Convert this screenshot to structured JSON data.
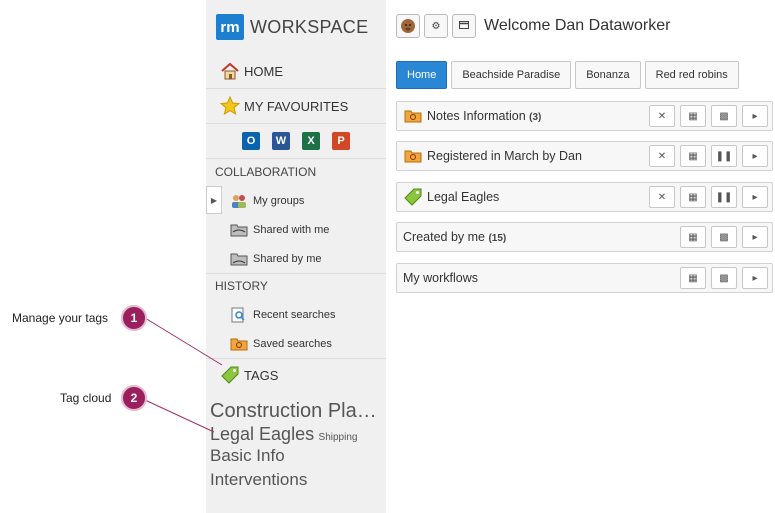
{
  "app": {
    "logo_mark": "rm",
    "logo_text": "WORKSPACE"
  },
  "sidebar": {
    "home": "HOME",
    "favourites": "MY FAVOURITES",
    "office_icons": [
      "outlook-icon",
      "word-icon",
      "excel-icon",
      "powerpoint-icon"
    ],
    "collaboration": {
      "title": "COLLABORATION",
      "items": [
        "My groups",
        "Shared with me",
        "Shared by me"
      ]
    },
    "history": {
      "title": "HISTORY",
      "items": [
        "Recent searches",
        "Saved searches"
      ]
    },
    "tags_label": "TAGS",
    "tag_cloud": {
      "construction": "Construction Pla…",
      "legal": "Legal Eagles",
      "shipping": "Shipping",
      "basic": "Basic Info",
      "interventions": "Interventions"
    }
  },
  "header": {
    "welcome": "Welcome Dan Dataworker"
  },
  "tabs": [
    {
      "label": "Home",
      "active": true
    },
    {
      "label": "Beachside Paradise",
      "active": false
    },
    {
      "label": "Bonanza",
      "active": false
    },
    {
      "label": "Red red robins",
      "active": false
    }
  ],
  "panels": [
    {
      "title": "Notes Information",
      "count": "(3)"
    },
    {
      "title": "Registered in March by Dan",
      "count": ""
    },
    {
      "title": "Legal Eagles",
      "count": ""
    },
    {
      "title": "Created by me",
      "count": "(15)"
    },
    {
      "title": "My workflows",
      "count": ""
    }
  ],
  "callouts": [
    {
      "number": "1",
      "label": "Manage your tags"
    },
    {
      "number": "2",
      "label": "Tag cloud"
    }
  ],
  "colors": {
    "accent": "#2a87d6",
    "callout": "#9a1f5c",
    "logo": "#1c7fcf"
  }
}
